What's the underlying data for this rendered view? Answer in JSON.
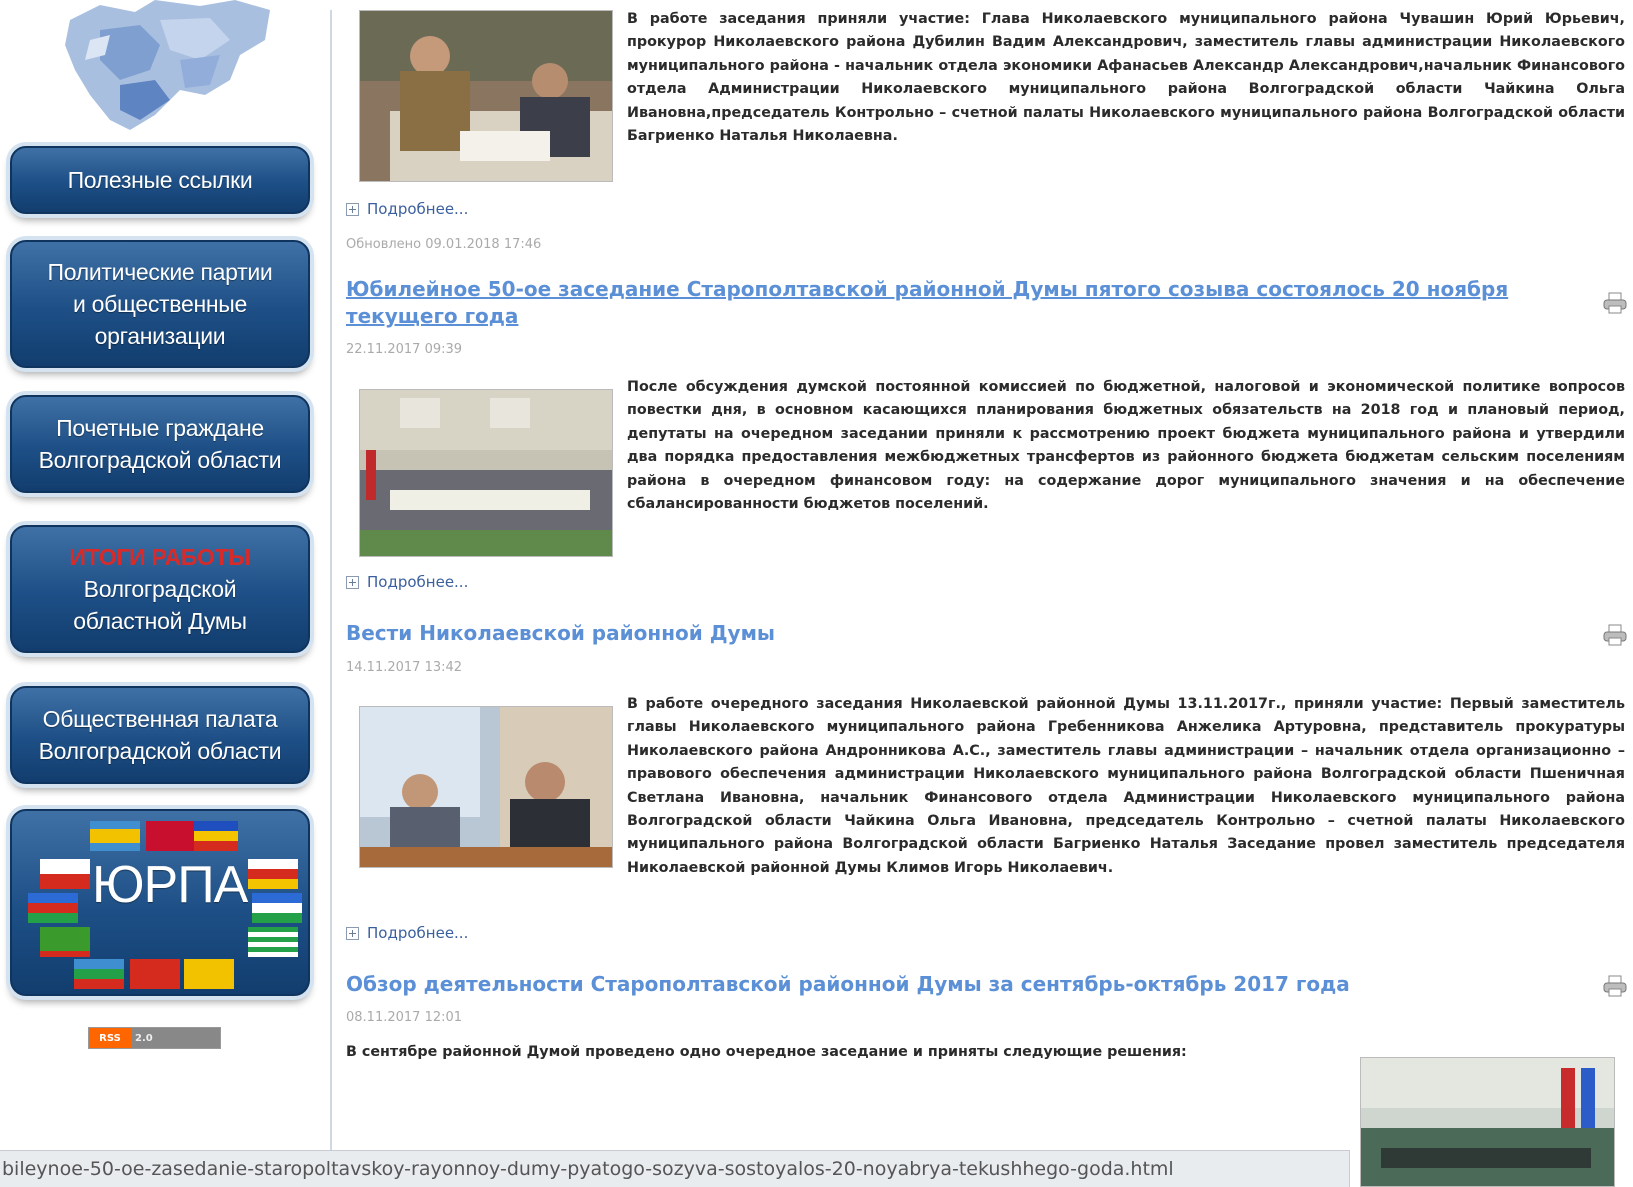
{
  "sidebar": {
    "buttons": {
      "useful_links": "Полезные ссылки",
      "parties": [
        "Политические партии",
        "и общественные",
        "организации"
      ],
      "citizens": [
        "Почетные граждане",
        "Волгоградской области"
      ],
      "results": [
        "ИТОГИ РАБОТЫ",
        "Волгоградской",
        "областной Думы"
      ],
      "chamber": [
        "Общественная палата",
        "Волгоградской области"
      ],
      "yurpa": "ЮРПА"
    },
    "rss": {
      "left": "RSS",
      "right": "2.0"
    }
  },
  "articles": [
    {
      "body": "В работе заседания приняли участие: Глава Николаевского муниципального района Чувашин Юрий Юрьевич, прокурор Николаевского района Дубилин Вадим Александрович, заместитель главы администрации Николаевского муниципального района - начальник отдела экономики Афанасьев Александр Александрович,начальник Финансового отдела Администрации Николаевского муниципального района Волгоградской области Чайкина Ольга Ивановна,председатель Контрольно – счетной палаты Николаевского муниципального района Волгоградской области Багриенко Наталья Николаевна.",
      "more": "Подробнее...",
      "updated": "Обновлено 09.01.2018 17:46"
    },
    {
      "title": "Юбилейное 50-ое заседание Старополтавской районной Думы пятого созыва состоялось 20 ноября текущего года",
      "date": "22.11.2017 09:39",
      "body": "После обсуждения думской постоянной комиссией по бюджетной, налоговой и экономической политике вопросов повестки дня, в основном касающихся планирования бюджетных обязательств на 2018 год и плановый период, депутаты на очередном заседании приняли к рассмотрению проект бюджета муниципального района и утвердили два порядка предоставления межбюджетных трансфертов из районного бюджета бюджетам сельским поселениям района в очередном финансовом году: на содержание дорог муниципального значения и на обеспечение сбалансированности бюджетов поселений.",
      "more": "Подробнее..."
    },
    {
      "title": "Вести Николаевской районной Думы",
      "date": "14.11.2017 13:42",
      "body": "В работе очередного заседания Николаевской районной Думы 13.11.2017г., приняли участие: Первый заместитель главы Николаевского муниципального района Гребенникова Анжелика Артуровна, представитель прокуратуры Николаевского района Андронникова А.С., заместитель главы администрации – начальник отдела организационно – правового обеспечения администрации Николаевского муниципального района Волгоградской области Пшеничная Светлана Ивановна, начальник Финансового отдела Администрации Николаевского муниципального района Волгоградской области Чайкина Ольга Ивановна, председатель Контрольно – счетной палаты Николаевского муниципального района Волгоградской области Багриенко Наталья Заседание провел заместитель председателя Николаевской районной Думы Климов Игорь Николаевич.",
      "more": "Подробнее..."
    },
    {
      "title": "Обзор деятельности Старополтавской районной Думы за сентябрь-октябрь 2017 года",
      "date": "08.11.2017 12:01",
      "intro": "В сентябре районной Думой проведено одно очередное заседание и приняты следующие решения:"
    }
  ],
  "status_bar": "bileynoe-50-oe-zasedanie-staropoltavskoy-rayonnoy-dumy-pyatogo-sozyva-sostoyalos-20-noyabrya-tekushhego-goda.html",
  "colors": {
    "title_link": "#5b8fd6",
    "button_blue": "#1d4f86",
    "accent_red": "#d92a2a"
  }
}
